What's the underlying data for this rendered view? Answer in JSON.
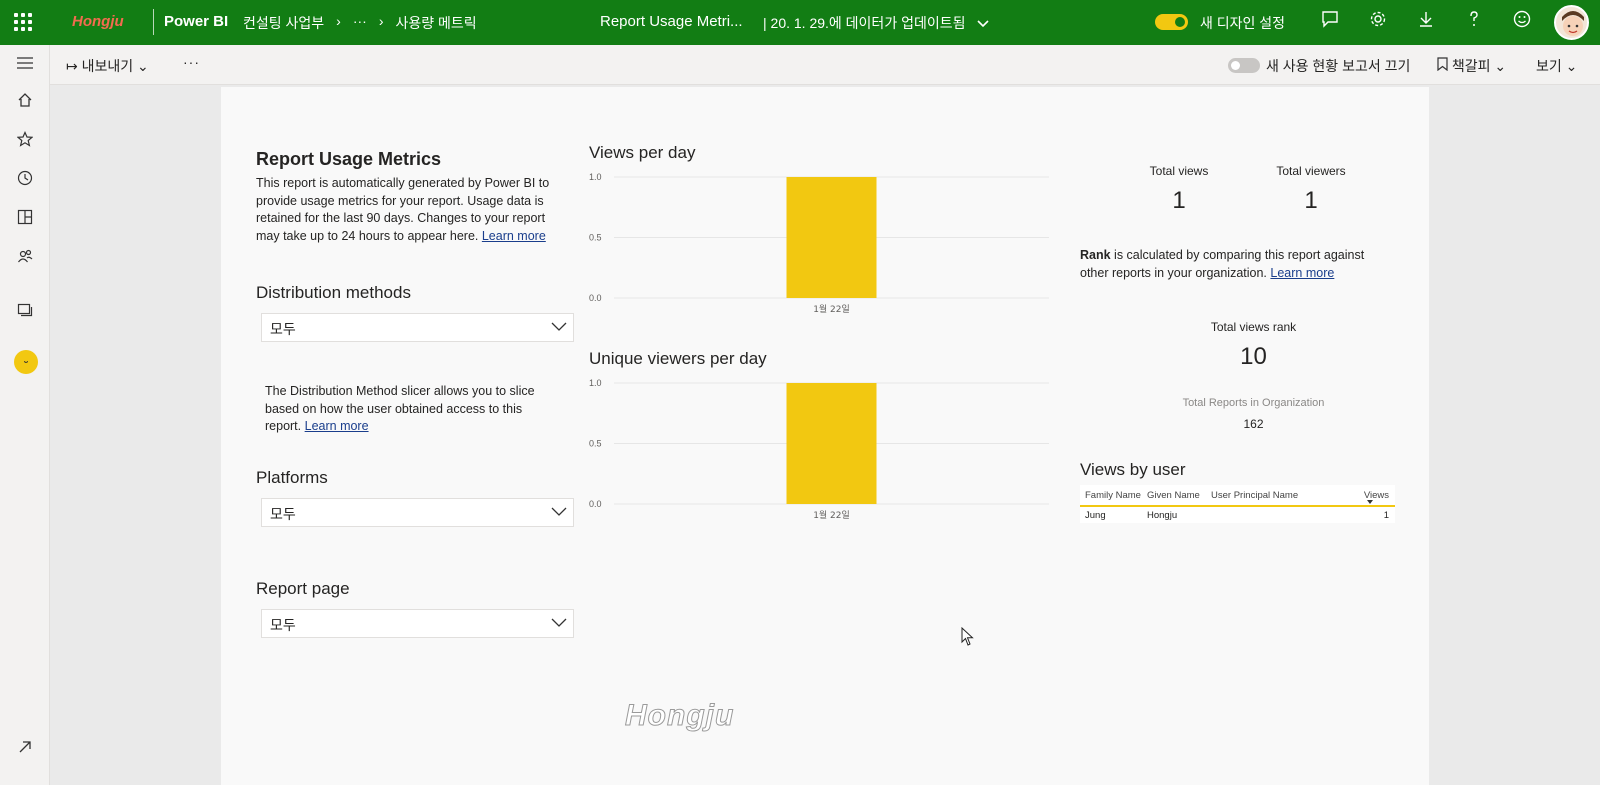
{
  "header": {
    "org_logo": "Hongju",
    "app_name": "Power BI",
    "breadcrumb": [
      "컨설팅 사업부",
      "›",
      "···",
      "›",
      "사용량 메트릭"
    ],
    "report_title": "Report Usage Metri...",
    "updated": "|  20. 1. 29.에 데이터가 업데이트됨",
    "new_design_label": "새 디자인 설정",
    "icons": [
      "waffle-icon",
      "comment-icon",
      "gear-icon",
      "download-icon",
      "help-icon",
      "smiley-icon",
      "avatar"
    ],
    "brand_color": "#127d14",
    "toggle_color": "#f2c811"
  },
  "commandbar": {
    "export_label": "내보내기",
    "more_label": "···",
    "toggle_label": "새 사용 현황 보고서 끄기",
    "bookmark_label": "책갈피",
    "view_label": "보기"
  },
  "rail": {
    "icons": [
      "menu-icon",
      "home-icon",
      "star-icon",
      "clock-icon",
      "apps-icon",
      "people-icon",
      "workspaces-icon",
      "workspace-badge",
      "expand-icon"
    ]
  },
  "report": {
    "title": "Report Usage Metrics",
    "description": "This report is automatically generated by Power BI to provide usage metrics for your report. Usage data is retained for the last 90 days. Changes to your report may take up to 24 hours to appear here.",
    "learn_more": "Learn more",
    "distribution": {
      "label": "Distribution methods",
      "value": "모두",
      "note": "The Distribution Method slicer allows you to slice based on how the user obtained access to this report."
    },
    "platforms": {
      "label": "Platforms",
      "value": "모두"
    },
    "report_page": {
      "label": "Report page",
      "value": "모두"
    },
    "kpis": {
      "total_views_label": "Total views",
      "total_views": "1",
      "total_viewers_label": "Total viewers",
      "total_viewers": "1"
    },
    "rank_note_bold": "Rank",
    "rank_note": " is calculated by comparing this report against other reports in your organization.",
    "rank_label": "Total views rank",
    "rank_value": "10",
    "org_reports_label": "Total Reports in Organization",
    "org_reports_value": "162",
    "views_by_user": {
      "title": "Views by user",
      "columns": [
        "Family Name",
        "Given Name",
        "User Principal Name",
        "Views"
      ],
      "rows": [
        [
          "Jung",
          "Hongju",
          "",
          "1"
        ]
      ]
    },
    "watermark": "Hongju"
  },
  "chart_data": [
    {
      "type": "bar",
      "title": "Views per day",
      "categories": [
        "1월 22일"
      ],
      "values": [
        1
      ],
      "yticks": [
        "0.0",
        "0.5",
        "1.0"
      ],
      "ylim": [
        0,
        1
      ],
      "bar_color": "#f2c811",
      "grid": true
    },
    {
      "type": "bar",
      "title": "Unique viewers per day",
      "categories": [
        "1월 22일"
      ],
      "values": [
        1
      ],
      "yticks": [
        "0.0",
        "0.5",
        "1.0"
      ],
      "ylim": [
        0,
        1
      ],
      "bar_color": "#f2c811",
      "grid": true
    }
  ]
}
